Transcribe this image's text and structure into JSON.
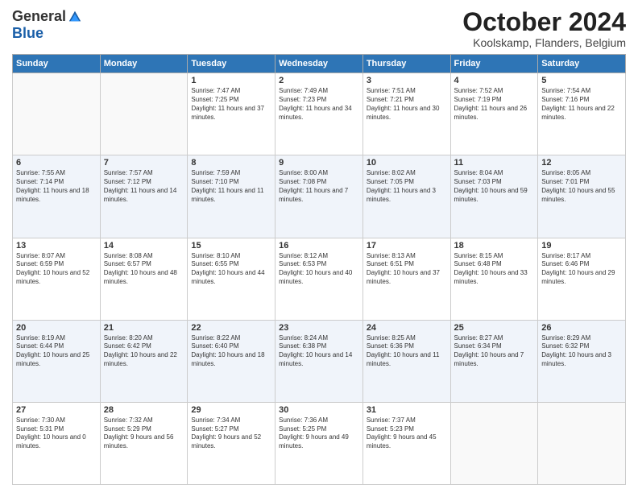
{
  "header": {
    "logo_general": "General",
    "logo_blue": "Blue",
    "month_title": "October 2024",
    "location": "Koolskamp, Flanders, Belgium"
  },
  "days_of_week": [
    "Sunday",
    "Monday",
    "Tuesday",
    "Wednesday",
    "Thursday",
    "Friday",
    "Saturday"
  ],
  "weeks": [
    [
      {
        "day": "",
        "detail": ""
      },
      {
        "day": "",
        "detail": ""
      },
      {
        "day": "1",
        "detail": "Sunrise: 7:47 AM\nSunset: 7:25 PM\nDaylight: 11 hours and 37 minutes."
      },
      {
        "day": "2",
        "detail": "Sunrise: 7:49 AM\nSunset: 7:23 PM\nDaylight: 11 hours and 34 minutes."
      },
      {
        "day": "3",
        "detail": "Sunrise: 7:51 AM\nSunset: 7:21 PM\nDaylight: 11 hours and 30 minutes."
      },
      {
        "day": "4",
        "detail": "Sunrise: 7:52 AM\nSunset: 7:19 PM\nDaylight: 11 hours and 26 minutes."
      },
      {
        "day": "5",
        "detail": "Sunrise: 7:54 AM\nSunset: 7:16 PM\nDaylight: 11 hours and 22 minutes."
      }
    ],
    [
      {
        "day": "6",
        "detail": "Sunrise: 7:55 AM\nSunset: 7:14 PM\nDaylight: 11 hours and 18 minutes."
      },
      {
        "day": "7",
        "detail": "Sunrise: 7:57 AM\nSunset: 7:12 PM\nDaylight: 11 hours and 14 minutes."
      },
      {
        "day": "8",
        "detail": "Sunrise: 7:59 AM\nSunset: 7:10 PM\nDaylight: 11 hours and 11 minutes."
      },
      {
        "day": "9",
        "detail": "Sunrise: 8:00 AM\nSunset: 7:08 PM\nDaylight: 11 hours and 7 minutes."
      },
      {
        "day": "10",
        "detail": "Sunrise: 8:02 AM\nSunset: 7:05 PM\nDaylight: 11 hours and 3 minutes."
      },
      {
        "day": "11",
        "detail": "Sunrise: 8:04 AM\nSunset: 7:03 PM\nDaylight: 10 hours and 59 minutes."
      },
      {
        "day": "12",
        "detail": "Sunrise: 8:05 AM\nSunset: 7:01 PM\nDaylight: 10 hours and 55 minutes."
      }
    ],
    [
      {
        "day": "13",
        "detail": "Sunrise: 8:07 AM\nSunset: 6:59 PM\nDaylight: 10 hours and 52 minutes."
      },
      {
        "day": "14",
        "detail": "Sunrise: 8:08 AM\nSunset: 6:57 PM\nDaylight: 10 hours and 48 minutes."
      },
      {
        "day": "15",
        "detail": "Sunrise: 8:10 AM\nSunset: 6:55 PM\nDaylight: 10 hours and 44 minutes."
      },
      {
        "day": "16",
        "detail": "Sunrise: 8:12 AM\nSunset: 6:53 PM\nDaylight: 10 hours and 40 minutes."
      },
      {
        "day": "17",
        "detail": "Sunrise: 8:13 AM\nSunset: 6:51 PM\nDaylight: 10 hours and 37 minutes."
      },
      {
        "day": "18",
        "detail": "Sunrise: 8:15 AM\nSunset: 6:48 PM\nDaylight: 10 hours and 33 minutes."
      },
      {
        "day": "19",
        "detail": "Sunrise: 8:17 AM\nSunset: 6:46 PM\nDaylight: 10 hours and 29 minutes."
      }
    ],
    [
      {
        "day": "20",
        "detail": "Sunrise: 8:19 AM\nSunset: 6:44 PM\nDaylight: 10 hours and 25 minutes."
      },
      {
        "day": "21",
        "detail": "Sunrise: 8:20 AM\nSunset: 6:42 PM\nDaylight: 10 hours and 22 minutes."
      },
      {
        "day": "22",
        "detail": "Sunrise: 8:22 AM\nSunset: 6:40 PM\nDaylight: 10 hours and 18 minutes."
      },
      {
        "day": "23",
        "detail": "Sunrise: 8:24 AM\nSunset: 6:38 PM\nDaylight: 10 hours and 14 minutes."
      },
      {
        "day": "24",
        "detail": "Sunrise: 8:25 AM\nSunset: 6:36 PM\nDaylight: 10 hours and 11 minutes."
      },
      {
        "day": "25",
        "detail": "Sunrise: 8:27 AM\nSunset: 6:34 PM\nDaylight: 10 hours and 7 minutes."
      },
      {
        "day": "26",
        "detail": "Sunrise: 8:29 AM\nSunset: 6:32 PM\nDaylight: 10 hours and 3 minutes."
      }
    ],
    [
      {
        "day": "27",
        "detail": "Sunrise: 7:30 AM\nSunset: 5:31 PM\nDaylight: 10 hours and 0 minutes."
      },
      {
        "day": "28",
        "detail": "Sunrise: 7:32 AM\nSunset: 5:29 PM\nDaylight: 9 hours and 56 minutes."
      },
      {
        "day": "29",
        "detail": "Sunrise: 7:34 AM\nSunset: 5:27 PM\nDaylight: 9 hours and 52 minutes."
      },
      {
        "day": "30",
        "detail": "Sunrise: 7:36 AM\nSunset: 5:25 PM\nDaylight: 9 hours and 49 minutes."
      },
      {
        "day": "31",
        "detail": "Sunrise: 7:37 AM\nSunset: 5:23 PM\nDaylight: 9 hours and 45 minutes."
      },
      {
        "day": "",
        "detail": ""
      },
      {
        "day": "",
        "detail": ""
      }
    ]
  ]
}
